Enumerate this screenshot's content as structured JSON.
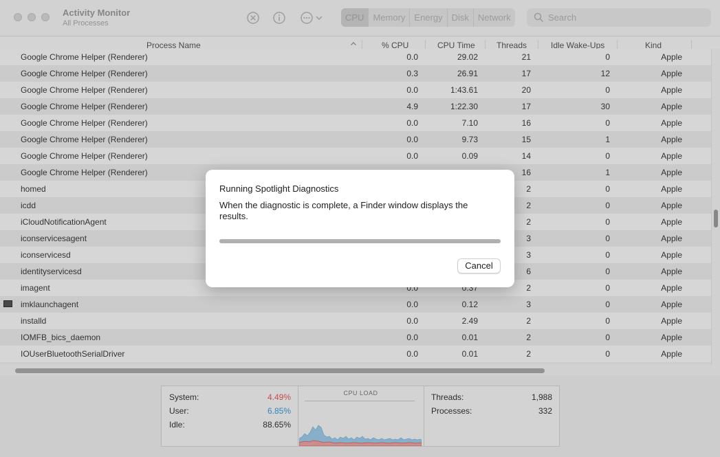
{
  "app": {
    "title": "Activity Monitor",
    "subtitle": "All Processes"
  },
  "toolbar": {
    "tabs": [
      "CPU",
      "Memory",
      "Energy",
      "Disk",
      "Network"
    ],
    "selected_tab": "CPU",
    "search_placeholder": "Search",
    "icons": [
      "stop-process-icon",
      "info-icon",
      "more-actions-icon",
      "chevron-down-icon",
      "search-icon"
    ]
  },
  "table": {
    "columns": [
      "Process Name",
      "% CPU",
      "CPU Time",
      "Threads",
      "Idle Wake-Ups",
      "Kind"
    ],
    "rows": [
      {
        "name": "Google Chrome Helper (Renderer)",
        "cpu": "0.0",
        "time": "29.02",
        "threads": "21",
        "wake": "0",
        "kind": "Apple"
      },
      {
        "name": "Google Chrome Helper (Renderer)",
        "cpu": "0.3",
        "time": "26.91",
        "threads": "17",
        "wake": "12",
        "kind": "Apple"
      },
      {
        "name": "Google Chrome Helper (Renderer)",
        "cpu": "0.0",
        "time": "1:43.61",
        "threads": "20",
        "wake": "0",
        "kind": "Apple"
      },
      {
        "name": "Google Chrome Helper (Renderer)",
        "cpu": "4.9",
        "time": "1:22.30",
        "threads": "17",
        "wake": "30",
        "kind": "Apple"
      },
      {
        "name": "Google Chrome Helper (Renderer)",
        "cpu": "0.0",
        "time": "7.10",
        "threads": "16",
        "wake": "0",
        "kind": "Apple"
      },
      {
        "name": "Google Chrome Helper (Renderer)",
        "cpu": "0.0",
        "time": "9.73",
        "threads": "15",
        "wake": "1",
        "kind": "Apple"
      },
      {
        "name": "Google Chrome Helper (Renderer)",
        "cpu": "0.0",
        "time": "0.09",
        "threads": "14",
        "wake": "0",
        "kind": "Apple"
      },
      {
        "name": "Google Chrome Helper (Renderer)",
        "cpu": "",
        "time": "",
        "threads": "16",
        "wake": "1",
        "kind": "Apple"
      },
      {
        "name": "homed",
        "cpu": "",
        "time": "",
        "threads": "2",
        "wake": "0",
        "kind": "Apple"
      },
      {
        "name": "icdd",
        "cpu": "",
        "time": "",
        "threads": "2",
        "wake": "0",
        "kind": "Apple"
      },
      {
        "name": "iCloudNotificationAgent",
        "cpu": "",
        "time": "",
        "threads": "2",
        "wake": "0",
        "kind": "Apple"
      },
      {
        "name": "iconservicesagent",
        "cpu": "",
        "time": "",
        "threads": "3",
        "wake": "0",
        "kind": "Apple"
      },
      {
        "name": "iconservicesd",
        "cpu": "",
        "time": "",
        "threads": "3",
        "wake": "0",
        "kind": "Apple"
      },
      {
        "name": "identityservicesd",
        "cpu": "",
        "time": "",
        "threads": "6",
        "wake": "0",
        "kind": "Apple"
      },
      {
        "name": "imagent",
        "cpu": "0.0",
        "time": "0.37",
        "threads": "2",
        "wake": "0",
        "kind": "Apple"
      },
      {
        "name": "imklaunchagent",
        "cpu": "0.0",
        "time": "0.12",
        "threads": "3",
        "wake": "0",
        "kind": "Apple"
      },
      {
        "name": "installd",
        "cpu": "0.0",
        "time": "2.49",
        "threads": "2",
        "wake": "0",
        "kind": "Apple"
      },
      {
        "name": "IOMFB_bics_daemon",
        "cpu": "0.0",
        "time": "0.01",
        "threads": "2",
        "wake": "0",
        "kind": "Apple"
      },
      {
        "name": "IOUserBluetoothSerialDriver",
        "cpu": "0.0",
        "time": "0.01",
        "threads": "2",
        "wake": "0",
        "kind": "Apple"
      }
    ]
  },
  "stats": {
    "system_label": "System:",
    "system_value": "4.49%",
    "user_label": "User:",
    "user_value": "6.85%",
    "idle_label": "Idle:",
    "idle_value": "88.65%",
    "cpu_load_title": "CPU LOAD",
    "threads_label": "Threads:",
    "threads_value": "1,988",
    "processes_label": "Processes:",
    "processes_value": "332",
    "colors": {
      "system": "#e05a5a",
      "user": "#3d98d6"
    }
  },
  "dialog": {
    "title": "Running Spotlight Diagnostics",
    "message": "When the diagnostic is complete, a Finder window displays the results.",
    "progress": 1.0,
    "cancel_label": "Cancel"
  }
}
